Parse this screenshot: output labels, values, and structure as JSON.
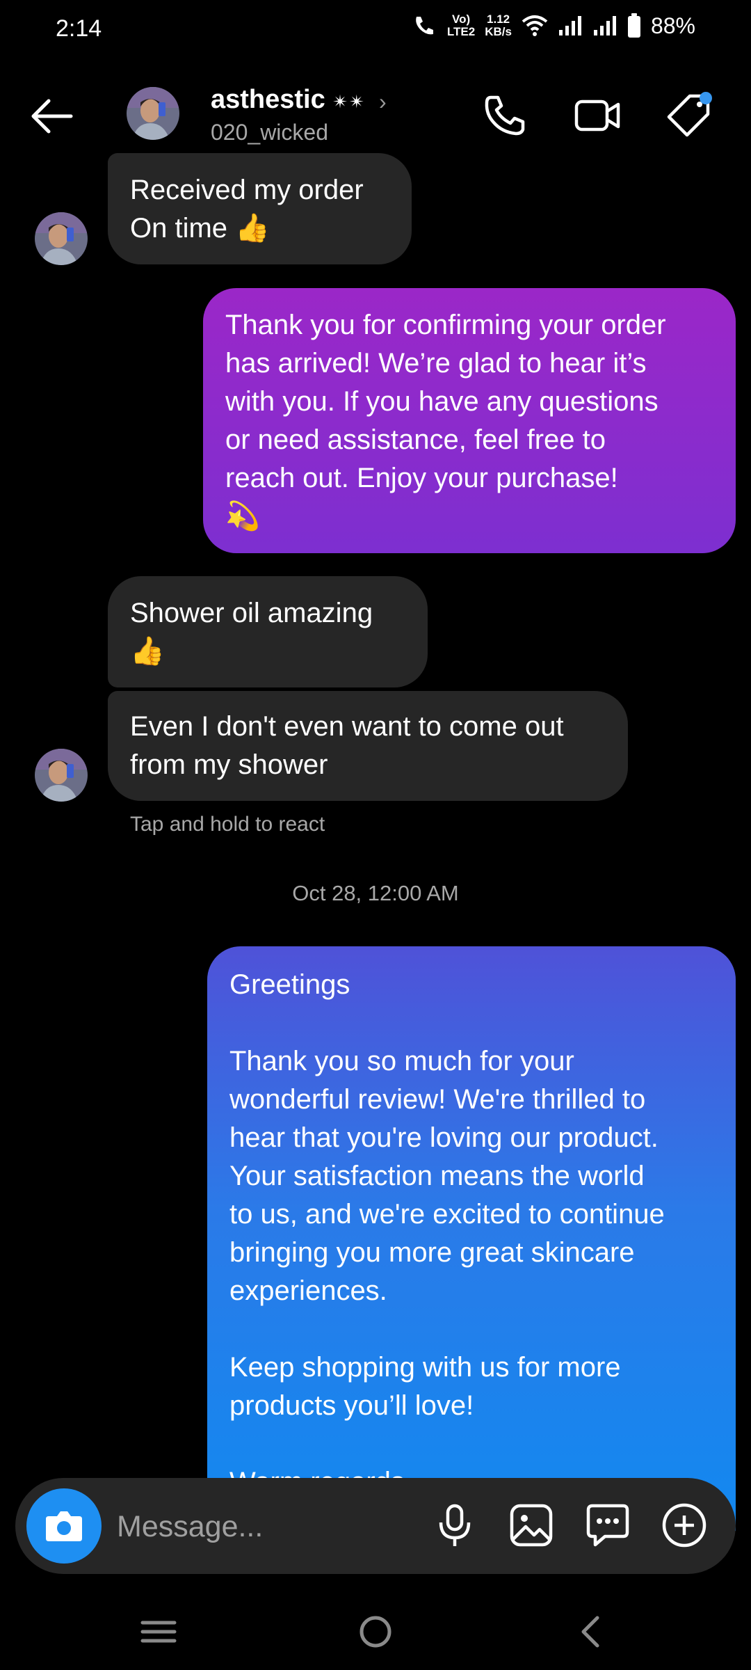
{
  "status_bar": {
    "time": "2:14",
    "network_top": "Vo)",
    "network_bottom": "LTE2",
    "speed_top": "1.12",
    "speed_bottom": "KB/s",
    "battery": "88%"
  },
  "header": {
    "name": "asthestic ⁣⁣⁣",
    "name_glyphs": "✴✴",
    "username": "020_wicked",
    "icons": [
      "back-arrow-icon",
      "phone-icon",
      "video-camera-icon",
      "tag-icon"
    ],
    "notification_dot_color": "#3797f0"
  },
  "messages": [
    {
      "side": "received",
      "lines": [
        "Received my order",
        "On time 👍"
      ]
    },
    {
      "side": "sent",
      "lines": [
        "Thank you for confirming your order",
        "has arrived! We’re glad to hear it’s",
        "with you. If you have any questions",
        "or need assistance, feel free to",
        "reach out. Enjoy your purchase!",
        "💫"
      ]
    },
    {
      "side": "received",
      "lines": [
        "Shower oil amazing",
        "👍"
      ]
    },
    {
      "side": "received",
      "lines": [
        "Even I don't even want to come out",
        "from my shower"
      ]
    },
    {
      "side": "sent",
      "lines": [
        "Greetings",
        "",
        "Thank you so much for your",
        "wonderful review! We're thrilled to",
        "hear that you're loving our product.",
        "Your satisfaction means the world",
        "to us, and we're excited to continue",
        "bringing you more great skincare",
        "experiences.",
        "",
        "Keep shopping with us for more",
        "products you’ll love!",
        "",
        "Warm regards"
      ]
    }
  ],
  "hint": "Tap and hold to react",
  "timestamp": "Oct 28, 12:00 AM",
  "composer": {
    "placeholder": "Message...",
    "icons": [
      "camera-icon",
      "microphone-icon",
      "gallery-icon",
      "sticker-chat-icon",
      "add-icon"
    ]
  },
  "colors": {
    "background": "#000000",
    "received_bubble": "#262626",
    "sent_purple": "#8a2bcd",
    "sent_blue": "#2b7ae8",
    "camera_button": "#1e8ff2"
  }
}
